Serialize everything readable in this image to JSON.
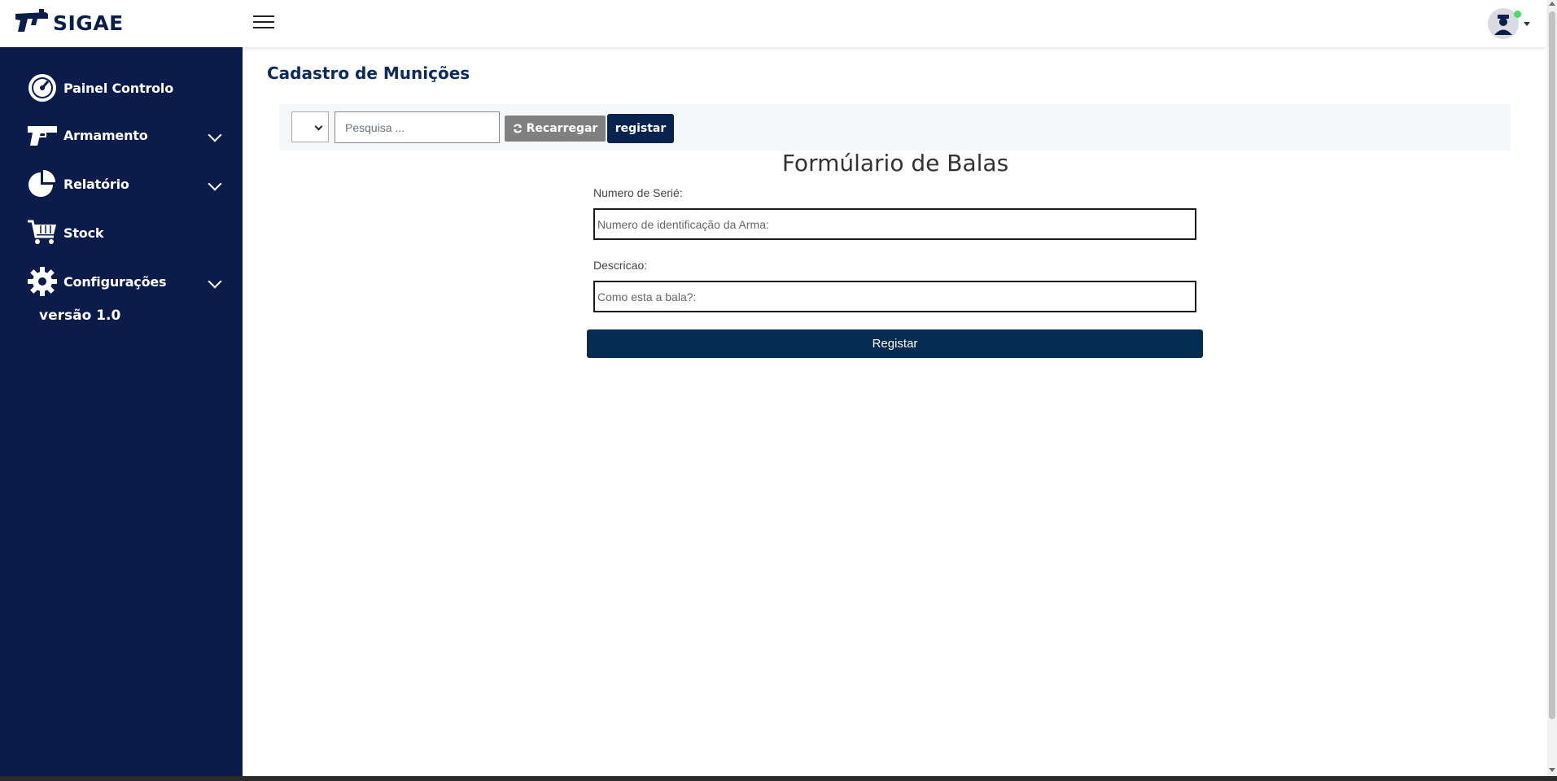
{
  "header": {
    "brand": "SIGAE"
  },
  "sidebar": {
    "items": [
      {
        "label": "Painel Controlo",
        "icon": "dashboard-gauge-icon",
        "expandable": false
      },
      {
        "label": "Armamento",
        "icon": "pistol-icon",
        "expandable": true
      },
      {
        "label": "Relatório",
        "icon": "pie-chart-icon",
        "expandable": true
      },
      {
        "label": "Stock",
        "icon": "cart-icon",
        "expandable": false
      },
      {
        "label": "Configurações",
        "icon": "gear-icon",
        "expandable": true
      }
    ],
    "version": "versão 1.0"
  },
  "main": {
    "page_title": "Cadastro de Munições",
    "toolbar": {
      "search_placeholder": "Pesquisa ...",
      "reload_label": "Recarregar",
      "register_label": "registar"
    },
    "form": {
      "title": "Formúlario de Balas",
      "serial_label": "Numero de Serié:",
      "serial_placeholder": "Numero de identificação da Arma:",
      "description_label": "Descricao:",
      "description_placeholder": "Como esta a bala?:",
      "submit_label": "Registar"
    }
  },
  "colors": {
    "sidebar_bg": "#0b1c4b",
    "primary": "#052c52",
    "reload_btn": "#808080",
    "online": "#4cd964"
  }
}
